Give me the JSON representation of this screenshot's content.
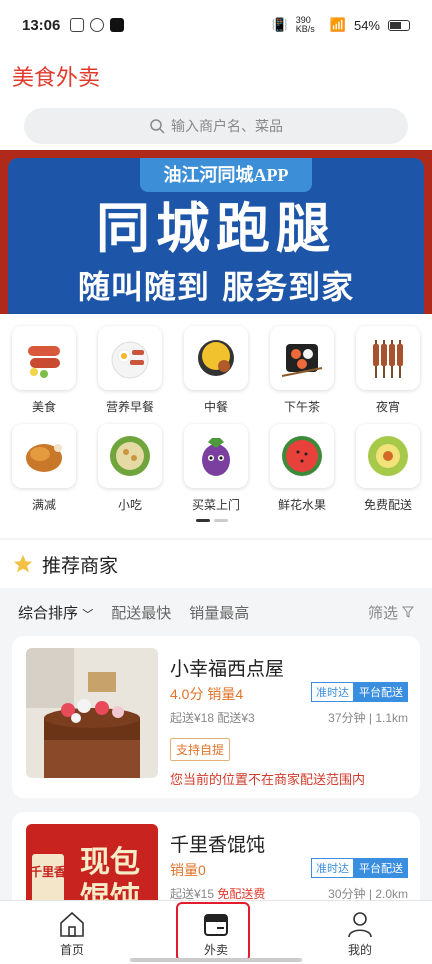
{
  "status": {
    "time": "13:06",
    "net": "390 KB/s",
    "battery": "54%"
  },
  "header": {
    "title": "美食外卖",
    "search_placeholder": "输入商户名、菜品"
  },
  "banner": {
    "top": "油江河同城APP",
    "main": "同城跑腿",
    "sub": "随叫随到  服务到家"
  },
  "categories": [
    {
      "label": "美食",
      "icon": "sausage-icon"
    },
    {
      "label": "营养早餐",
      "icon": "breakfast-icon"
    },
    {
      "label": "中餐",
      "icon": "rice-icon"
    },
    {
      "label": "下午茶",
      "icon": "sushi-icon"
    },
    {
      "label": "夜宵",
      "icon": "skewer-icon"
    },
    {
      "label": "满减",
      "icon": "roast-chicken-icon"
    },
    {
      "label": "小吃",
      "icon": "snack-icon"
    },
    {
      "label": "买菜上门",
      "icon": "eggplant-icon"
    },
    {
      "label": "鲜花水果",
      "icon": "watermelon-icon"
    },
    {
      "label": "免费配送",
      "icon": "gift-icon"
    }
  ],
  "recommend": {
    "title": "推荐商家"
  },
  "sort": {
    "s1": "综合排序",
    "s2": "配送最快",
    "s3": "销量最高",
    "filter": "筛选"
  },
  "shops": [
    {
      "name": "小幸福西点屋",
      "score": "4.0分",
      "sales": "销量4",
      "min": "起送¥18",
      "fee": "配送¥3",
      "time": "37分钟",
      "dist": "1.1km",
      "tag1": "准时达",
      "tag2": "平台配送",
      "pickup": "支持自提",
      "warn": "您当前的位置不在商家配送范围内"
    },
    {
      "name": "千里香馄饨",
      "sales": "销量0",
      "min": "起送¥15",
      "fee": "免配送费",
      "time": "30分钟",
      "dist": "2.0km",
      "tag1": "准时达",
      "tag2": "平台配送",
      "sign1": "千里香",
      "sign2": "现包",
      "sign3": "馄饨"
    }
  ],
  "tabs": {
    "home": "首页",
    "takeout": "外卖",
    "mine": "我的"
  },
  "colors": {
    "accent": "#e23b2e",
    "blue": "#3a8ee0",
    "banner_bg": "#1d55a8"
  }
}
